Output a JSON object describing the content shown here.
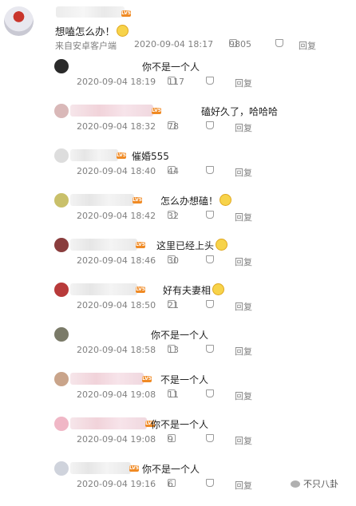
{
  "comment": {
    "text": "想嗑怎么办！",
    "emoji": "smile-emoji",
    "source": "来自安卓客户端",
    "time": "2020-09-04 18:17",
    "likes": "9805",
    "reply_label": "回复",
    "level_badge": "LV5"
  },
  "replies": [
    {
      "text": "你不是一个人",
      "time": "2020-09-04 18:19",
      "likes": "117",
      "reply_label": "回复"
    },
    {
      "text": "磕好久了，哈哈哈",
      "time": "2020-09-04 18:32",
      "likes": "78",
      "reply_label": "回复"
    },
    {
      "text": "催婚555",
      "time": "2020-09-04 18:40",
      "likes": "44",
      "reply_label": "回复"
    },
    {
      "text": "怎么办想磕！",
      "time": "2020-09-04 18:42",
      "likes": "32",
      "reply_label": "回复"
    },
    {
      "text": "这里已经上头",
      "time": "2020-09-04 18:46",
      "likes": "30",
      "reply_label": "回复"
    },
    {
      "text": "好有夫妻相",
      "time": "2020-09-04 18:50",
      "likes": "21",
      "reply_label": "回复"
    },
    {
      "text": "你不是一个人",
      "time": "2020-09-04 18:58",
      "likes": "13",
      "reply_label": "回复"
    },
    {
      "text": "不是一个人",
      "time": "2020-09-04 19:08",
      "likes": "11",
      "reply_label": "回复"
    },
    {
      "text": "你不是一个人",
      "time": "2020-09-04 19:08",
      "likes": "9",
      "reply_label": "回复"
    },
    {
      "text": "你不是一个人",
      "time": "2020-09-04 19:16",
      "likes": "6",
      "reply_label": "回复"
    }
  ],
  "watermark": "不只八卦",
  "colors": {
    "accent": "#f08a24",
    "meta": "#808080"
  }
}
